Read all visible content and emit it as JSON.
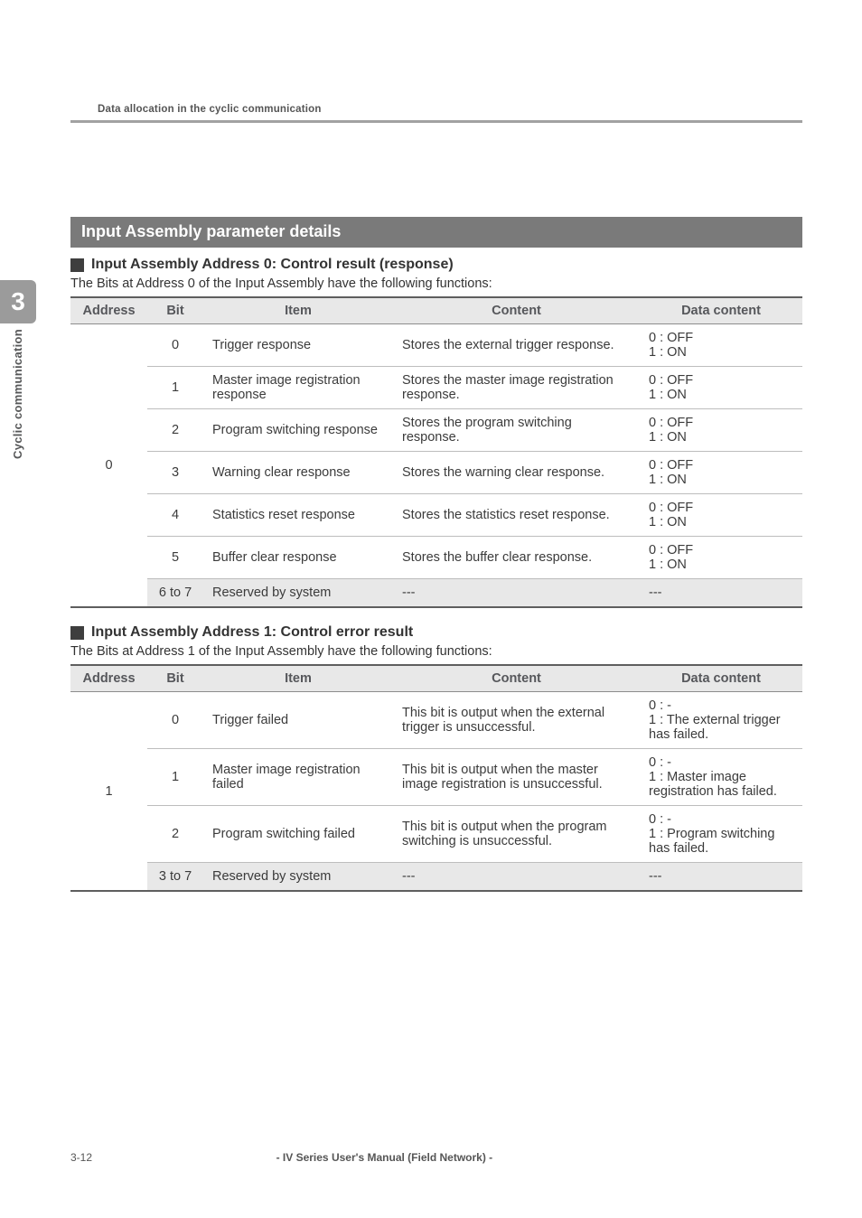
{
  "breadcrumb": "Data allocation in the cyclic communication",
  "side": {
    "chapterNum": "3",
    "chapterLabel": "Cyclic communication"
  },
  "banner": "Input Assembly parameter details",
  "sec1": {
    "heading": "Input Assembly Address 0: Control result (response)",
    "desc": "The Bits at Address 0 of the Input Assembly have the following functions:",
    "headers": {
      "addr": "Address",
      "bit": "Bit",
      "item": "Item",
      "content": "Content",
      "data": "Data content"
    },
    "address": "0",
    "rows": [
      {
        "bit": "0",
        "item": "Trigger response",
        "content": "Stores the external trigger response.",
        "data": "0 : OFF\n1 : ON"
      },
      {
        "bit": "1",
        "item": "Master image registration response",
        "content": "Stores the master image registration response.",
        "data": "0 : OFF\n1 : ON"
      },
      {
        "bit": "2",
        "item": "Program switching response",
        "content": "Stores the program switching response.",
        "data": "0 : OFF\n1 : ON"
      },
      {
        "bit": "3",
        "item": "Warning clear response",
        "content": "Stores the warning clear response.",
        "data": "0 : OFF\n1 : ON"
      },
      {
        "bit": "4",
        "item": "Statistics reset response",
        "content": "Stores the statistics reset response.",
        "data": "0 : OFF\n1 : ON"
      },
      {
        "bit": "5",
        "item": "Buffer clear response",
        "content": "Stores the buffer clear response.",
        "data": "0 : OFF\n1 : ON"
      },
      {
        "bit": "6 to 7",
        "item": "Reserved by system",
        "content": "---",
        "data": "---",
        "reserved": true
      }
    ]
  },
  "sec2": {
    "heading": "Input Assembly Address 1: Control error result",
    "desc": "The Bits at Address 1 of the Input Assembly have the following functions:",
    "headers": {
      "addr": "Address",
      "bit": "Bit",
      "item": "Item",
      "content": "Content",
      "data": "Data content"
    },
    "address": "1",
    "rows": [
      {
        "bit": "0",
        "item": "Trigger failed",
        "content": "This bit is output when the external trigger is unsuccessful.",
        "data": "0 : -\n1 : The external trigger has failed."
      },
      {
        "bit": "1",
        "item": "Master image registration failed",
        "content": "This bit is output when the master image registration is unsuccessful.",
        "data": "0 : -\n1 : Master image registration has failed."
      },
      {
        "bit": "2",
        "item": "Program switching failed",
        "content": "This bit is output when the program switching is unsuccessful.",
        "data": "0 : -\n1 : Program switching has failed."
      },
      {
        "bit": "3 to 7",
        "item": "Reserved by system",
        "content": "---",
        "data": "---",
        "reserved": true
      }
    ]
  },
  "footer": {
    "page": "3-12",
    "manual": "- IV Series User's Manual (Field Network) -"
  }
}
